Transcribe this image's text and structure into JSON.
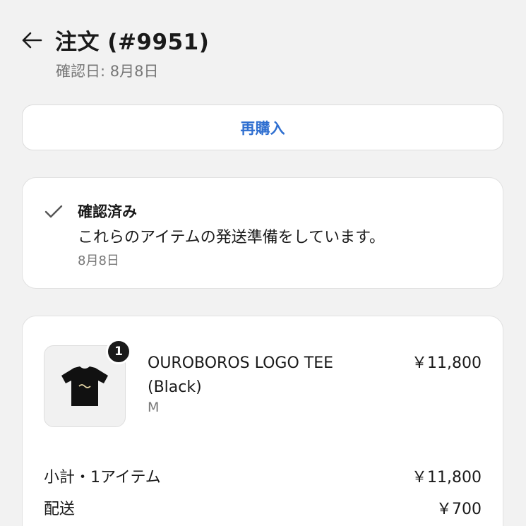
{
  "header": {
    "title": "注文 (#9951)",
    "confirmed_date": "確認日: 8月8日"
  },
  "rebuy_label": "再購入",
  "status": {
    "title": "確認済み",
    "message": "これらのアイテムの発送準備をしています。",
    "date": "8月8日"
  },
  "item": {
    "quantity": "1",
    "name": "OUROBOROS LOGO TEE (Black)",
    "variant": "M",
    "price": "￥11,800"
  },
  "summary": {
    "subtotal_label": "小計・1アイテム",
    "subtotal_value": "￥11,800",
    "shipping_label": "配送",
    "shipping_value": "￥700"
  },
  "colors": {
    "accent": "#2f6fd0",
    "background": "#f2f2f2",
    "card": "#ffffff"
  },
  "icons": [
    "arrow-left-icon",
    "checkmark-icon",
    "tshirt-icon"
  ]
}
